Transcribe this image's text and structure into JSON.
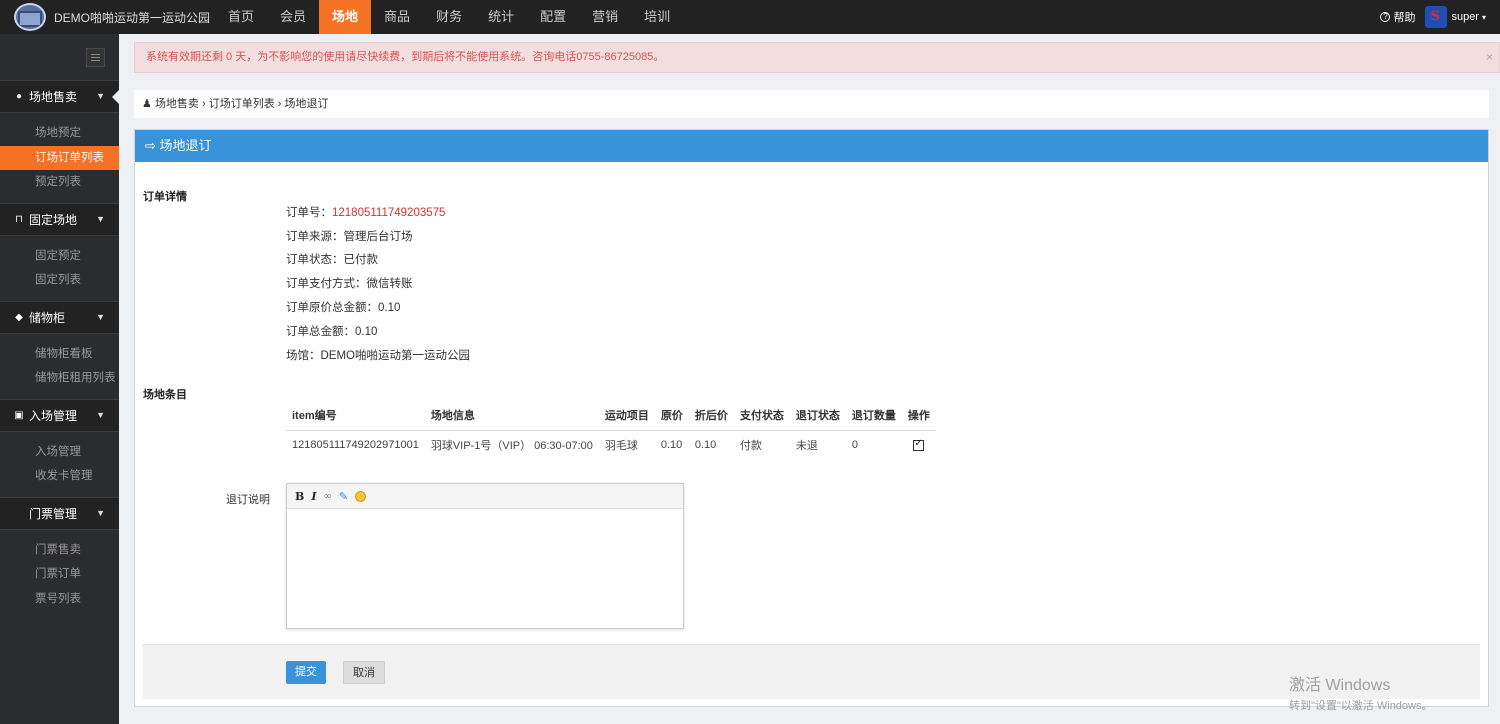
{
  "app": {
    "logo_text": "DEMO啪啪运动第一运动公园"
  },
  "nav": {
    "items": [
      "首页",
      "会员",
      "场地",
      "商品",
      "财务",
      "统计",
      "配置",
      "营销",
      "培训"
    ],
    "active": "场地"
  },
  "topbar": {
    "help_label": "帮助",
    "username": "super"
  },
  "sidebar": {
    "groups": [
      {
        "icon": "globe-icon",
        "label": "场地售卖",
        "items": [
          "场地预定",
          "订场订单列表",
          "预定列表"
        ],
        "active_item": "订场订单列表"
      },
      {
        "icon": "bookmark-icon",
        "label": "固定场地",
        "items": [
          "固定预定",
          "固定列表"
        ]
      },
      {
        "icon": "cube-icon",
        "label": "储物柜",
        "items": [
          "储物柜看板",
          "储物柜租用列表"
        ]
      },
      {
        "icon": "id-card-icon",
        "label": "入场管理",
        "items": [
          "入场管理",
          "收发卡管理"
        ]
      },
      {
        "icon": "",
        "label": "门票管理",
        "items": [
          "门票售卖",
          "门票订单",
          "票号列表"
        ]
      }
    ]
  },
  "alert": {
    "text": "系统有效期还剩 0 天，为不影响您的使用请尽快续费，到期后将不能使用系统。咨询电话0755-86725085。",
    "close": "×"
  },
  "breadcrumb": {
    "items": [
      "场地售卖",
      "订场订单列表",
      "场地退订"
    ]
  },
  "panel": {
    "title": "场地退订"
  },
  "order": {
    "section_title": "订单详情",
    "lines": [
      {
        "label": "订单号：",
        "value": "121805111749203575"
      },
      {
        "label": "订单来源：",
        "value": "管理后台订场"
      },
      {
        "label": "订单状态：",
        "value": "已付款"
      },
      {
        "label": "订单支付方式：",
        "value": "微信转账"
      },
      {
        "label": "订单原价总金额：",
        "value": "0.10"
      },
      {
        "label": "订单总金额：",
        "value": "0.10"
      },
      {
        "label": "场馆：",
        "value": "DEMO啪啪运动第一运动公园"
      }
    ]
  },
  "items": {
    "section_title": "场地条目",
    "headers": [
      "item编号",
      "场地信息",
      "运动项目",
      "原价",
      "折后价",
      "支付状态",
      "退订状态",
      "退订数量",
      "操作"
    ],
    "rows": [
      {
        "id": "121805111749202971001",
        "venue": "羽球VIP-1号（VIP）  06:30-07:00",
        "sport": "羽毛球",
        "price": "0.10",
        "discount_price": "0.10",
        "pay_status": "付款",
        "refund_status": "未退",
        "refund_qty": "0",
        "selected": true
      }
    ]
  },
  "refund": {
    "label": "退订说明"
  },
  "buttons": {
    "submit": "提交",
    "cancel": "取消"
  },
  "watermark": {
    "line1": "激活 Windows",
    "line2": "转到\"设置\"以激活 Windows。"
  }
}
